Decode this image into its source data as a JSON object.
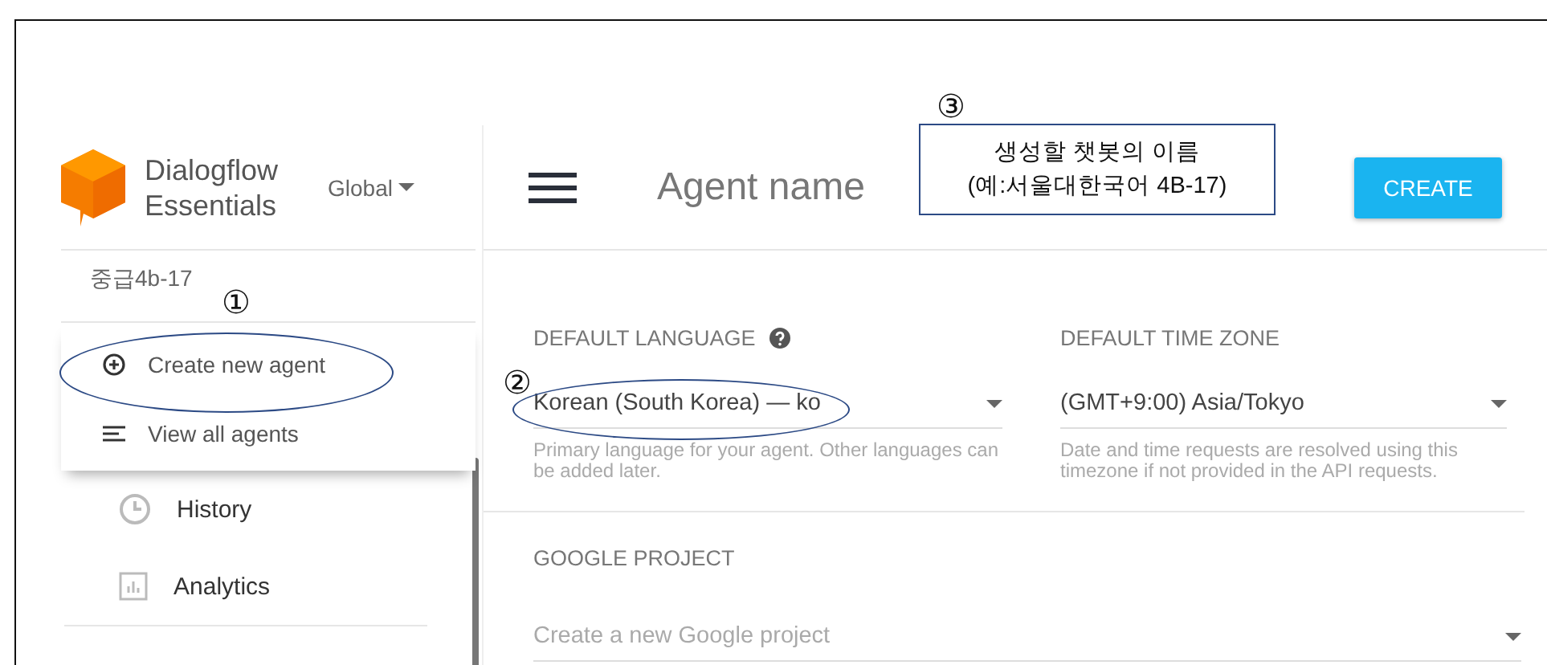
{
  "sidebar": {
    "logo": {
      "line1": "Dialogflow",
      "line2": "Essentials"
    },
    "region": "Global",
    "agent": "중급4b-17",
    "menu": [
      {
        "kind": "add",
        "label": "Create new agent"
      },
      {
        "kind": "list",
        "label": "View all agents"
      }
    ],
    "nav": [
      {
        "kind": "history",
        "label": "History"
      },
      {
        "kind": "analytics",
        "label": "Analytics"
      }
    ]
  },
  "header": {
    "agent_name": {
      "placeholder": "Agent name"
    },
    "create_button": "CREATE"
  },
  "form": {
    "fields": [
      {
        "label": "DEFAULT LANGUAGE",
        "help_icon": true,
        "value": "Korean (South Korea) — ko",
        "helper": "Primary language for your agent. Other languages can be added later."
      },
      {
        "label": "DEFAULT TIME ZONE",
        "help_icon": false,
        "value": "(GMT+9:00) Asia/Tokyo",
        "helper": "Date and time requests are resolved using this timezone if not provided in the API requests."
      }
    ],
    "google_project": {
      "label": "GOOGLE PROJECT",
      "placeholder": "Create a new Google project"
    }
  },
  "annotations": [
    {
      "kind": "ellipse",
      "number": "①"
    },
    {
      "kind": "ellipse",
      "number": "②"
    },
    {
      "kind": "box",
      "number": "③",
      "lines": [
        "생성할 챗봇의 이름",
        "(예:서울대한국어 4B-17)"
      ]
    }
  ]
}
